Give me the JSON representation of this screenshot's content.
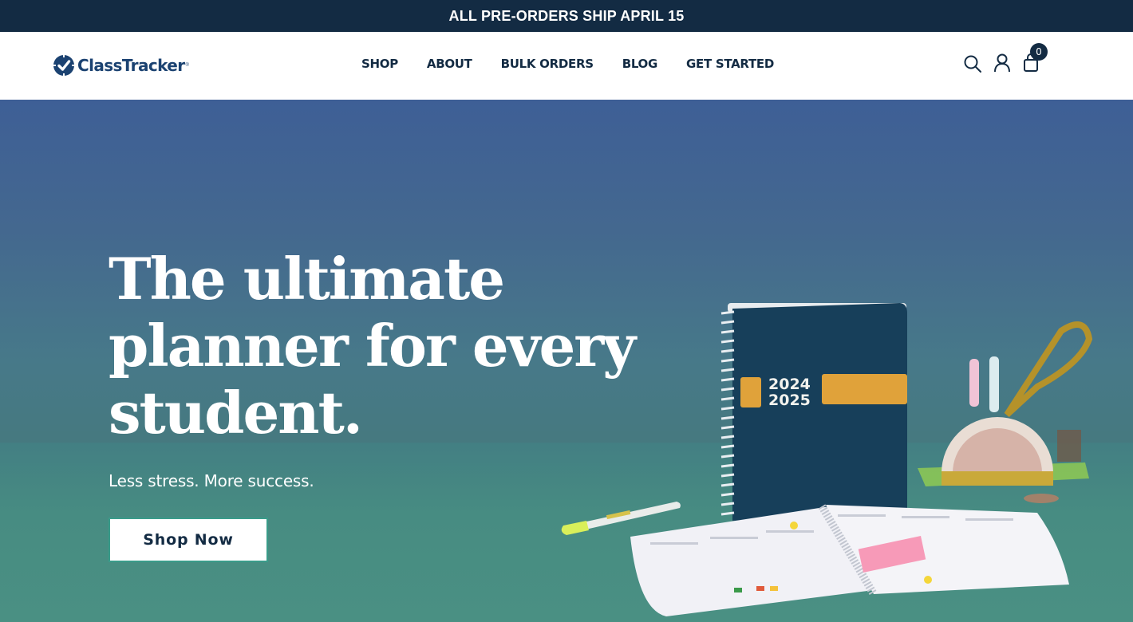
{
  "announcement": {
    "text": "ALL PRE-ORDERS SHIP APRIL 15"
  },
  "header": {
    "logo": {
      "text": "ClassTracker",
      "registered": "®"
    },
    "nav": [
      {
        "label": "SHOP"
      },
      {
        "label": "ABOUT"
      },
      {
        "label": "BULK ORDERS"
      },
      {
        "label": "BLOG"
      },
      {
        "label": "GET STARTED"
      }
    ],
    "icons": {
      "search": "search-icon",
      "account": "account-icon",
      "cart": "cart-icon"
    },
    "cart_count": "0"
  },
  "hero": {
    "title_lines": [
      "The ultimate",
      "planner for every",
      "student."
    ],
    "subtitle": "Less stress. More success.",
    "cta_label": "Shop Now",
    "product": {
      "year_top": "2024",
      "year_bottom": "2025"
    }
  },
  "colors": {
    "announcement_bg": "#132b43",
    "brand_blue": "#1b4271",
    "nav_text": "#132b43",
    "hero_top": "#3e5f96",
    "hero_bottom": "#4a8e82",
    "cta_border": "#3a9c8a",
    "planner_cover": "#173f5a",
    "planner_band": "#e0a23a"
  }
}
